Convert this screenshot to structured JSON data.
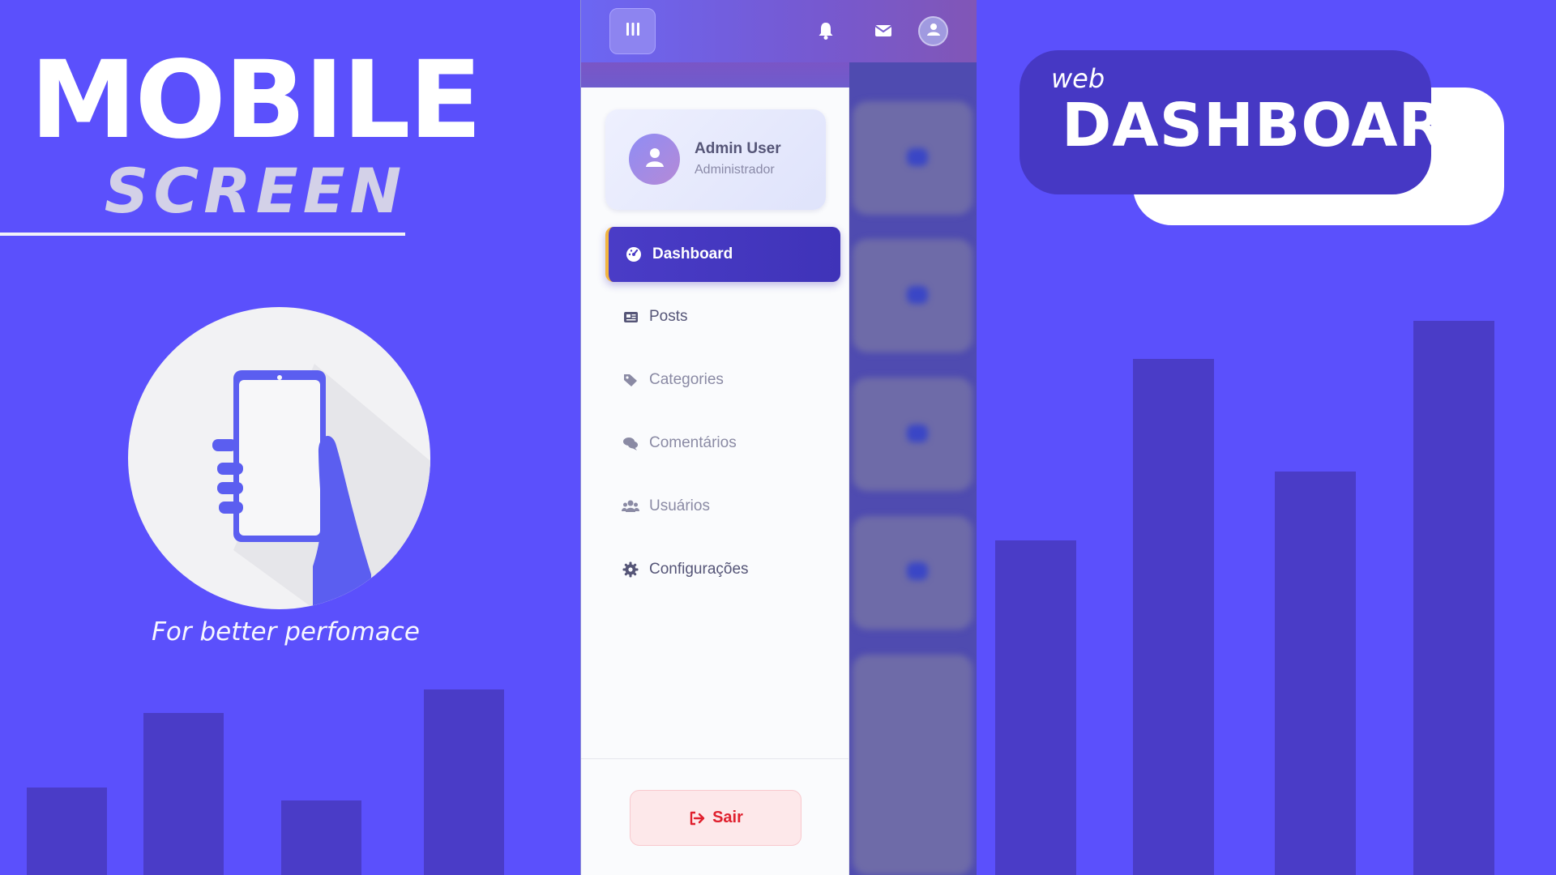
{
  "promo_left": {
    "title": "MOBILE",
    "subtitle": "SCREEN",
    "tagline": "For better perfomace",
    "illustration_icon": "hand-holding-phone-icon"
  },
  "promo_right": {
    "badge_small": "web",
    "badge_large": "DASHBOARD"
  },
  "colors": {
    "background": "#5b50fc",
    "bars": "#4a3cc7",
    "accent": "#4a3cc7",
    "active_border": "#f2b541",
    "logout_text": "#e0202e"
  },
  "topbar": {
    "menu_icon": "menu-bars-icon",
    "icons": [
      "bell-icon",
      "envelope-icon",
      "user-circle-icon"
    ]
  },
  "profile": {
    "name": "Admin User",
    "role": "Administrador",
    "icon": "user-icon"
  },
  "nav": {
    "items": [
      {
        "label": "Dashboard",
        "icon": "tachometer-icon",
        "active": true
      },
      {
        "label": "Posts",
        "icon": "newspaper-icon",
        "active": false
      },
      {
        "label": "Categories",
        "icon": "tags-icon",
        "active": false
      },
      {
        "label": "Comentários",
        "icon": "comments-icon",
        "active": false
      },
      {
        "label": "Usuários",
        "icon": "users-icon",
        "active": false
      },
      {
        "label": "Configurações",
        "icon": "gear-icon",
        "active": false
      }
    ]
  },
  "logout": {
    "label": "Sair",
    "icon": "sign-out-icon"
  }
}
